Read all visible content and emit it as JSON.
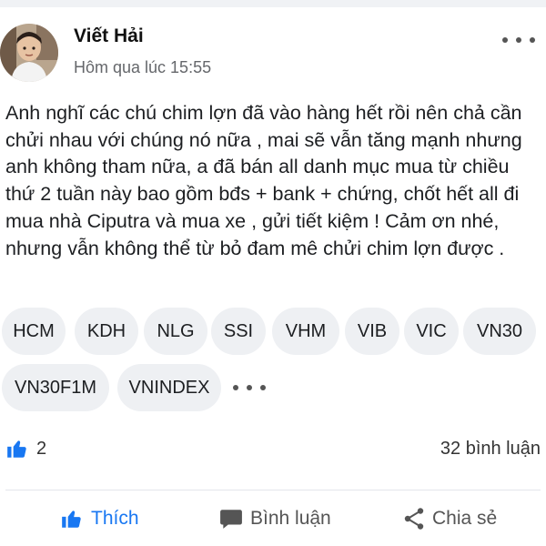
{
  "post": {
    "author": "Viết Hải",
    "timestamp": "Hôm qua lúc 15:55",
    "text": "Anh nghĩ các chú chim lợn đã vào hàng hết rồi nên chả cần chửi nhau với chúng nó nữa , mai sẽ vẫn tăng mạnh nhưng anh không tham nữa, a đã bán all danh mục mua từ chiều thứ 2 tuần này bao gồm bđs + bank + chứng, chốt hết all đi mua nhà Ciputra và mua xe , gửi tiết kiệm ! Cảm ơn nhé, nhưng vẫn không thể từ bỏ đam mê chửi chim lợn được ."
  },
  "tags": [
    "HCM",
    "KDH",
    "NLG",
    "SSI",
    "VHM",
    "VIB",
    "VIC",
    "VN30",
    "VN30F1M",
    "VNINDEX"
  ],
  "stats": {
    "likes": "2",
    "comments": "32 bình luận"
  },
  "actions": {
    "like": "Thích",
    "comment": "Bình luận",
    "share": "Chia sẻ"
  },
  "icons": {
    "more": "more-horizontal-icon",
    "like": "thumbs-up-icon",
    "comment": "speech-bubble-icon",
    "share": "share-nodes-icon"
  },
  "colors": {
    "accent": "#1877f2",
    "tag_bg": "#eef0f3",
    "secondary_text": "#65676b"
  }
}
